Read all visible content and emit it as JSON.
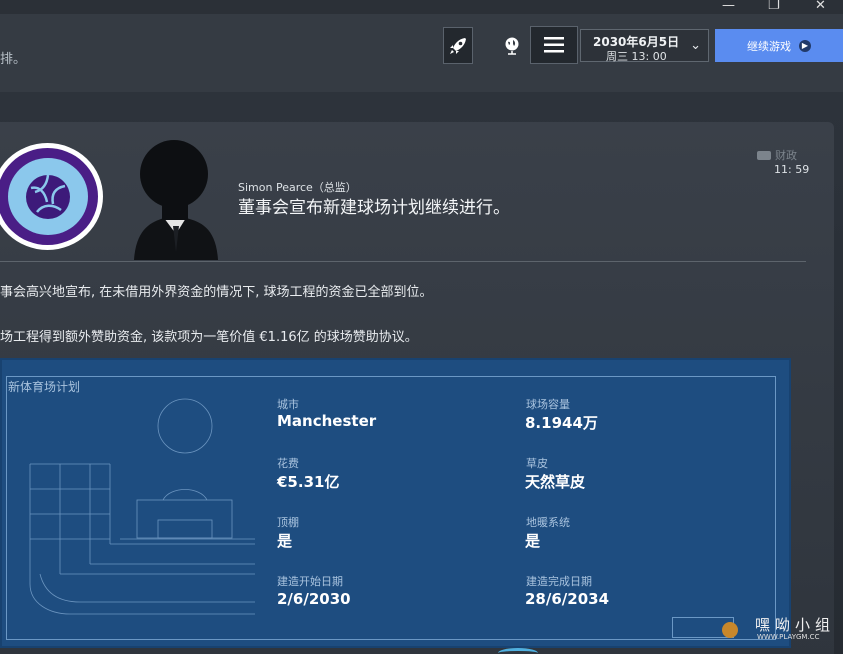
{
  "window": {
    "min_icon": "—",
    "max_icon": "❐",
    "close_icon": "✕"
  },
  "topbar": {
    "left_text": "排。",
    "date_line1": "2030年6月5日",
    "date_line2": "周三 13: 00",
    "continue_label": "继续游戏",
    "icons": [
      "rocket-icon",
      "globe-icon",
      "menu-icon",
      "chevron-down-icon"
    ]
  },
  "message": {
    "sender": "Simon Pearce（总监）",
    "headline": "董事会宣布新建球场计划继续进行。",
    "tag": "财政",
    "time": "11: 59",
    "para1": "事会高兴地宣布, 在未借用外界资金的情况下, 球场工程的资金已全部到位。",
    "para2": "场工程得到额外赞助资金, 该款项为一笔价值 €1.16亿 的球场赞助协议。"
  },
  "stadium_panel": {
    "title": "新体育场计划",
    "fields": {
      "city_label": "城市",
      "city_value": "Manchester",
      "capacity_label": "球场容量",
      "capacity_value": "8.1944万",
      "cost_label": "花费",
      "cost_value": "€5.31亿",
      "pitch_label": "草皮",
      "pitch_value": "天然草皮",
      "roof_label": "顶棚",
      "roof_value": "是",
      "heating_label": "地暖系统",
      "heating_value": "是",
      "start_label": "建造开始日期",
      "start_value": "2/6/2030",
      "end_label": "建造完成日期",
      "end_value": "28/6/2034"
    }
  },
  "watermark": {
    "text": "嘿呦小组",
    "url": "WWW.PLAYGM.CC"
  }
}
